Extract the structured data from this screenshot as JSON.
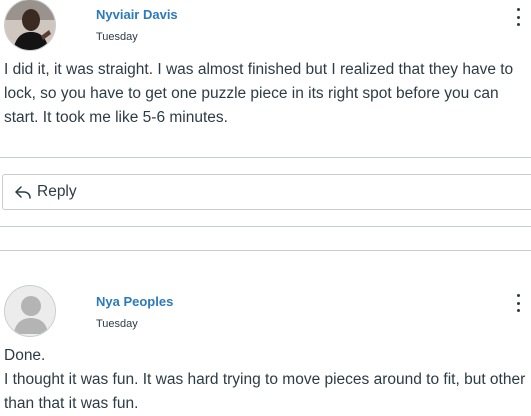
{
  "posts": [
    {
      "author": "Nyviair Davis",
      "date": "Tuesday",
      "avatar": "user-photo-avatar",
      "body": [
        "I did it, it was straight. I was almost finished but I realized that they have to lock, so you have to get one puzzle piece in its right spot before you can start. It took me like 5-6 minutes."
      ]
    },
    {
      "author": "Nya Peoples",
      "date": "Tuesday",
      "avatar": "default-user-avatar",
      "body": [
        "Done.",
        "I thought it was fun. It was hard trying to move pieces around to fit, but other than that it was fun."
      ]
    }
  ],
  "reply": {
    "label": "Reply",
    "icon": "reply-arrow-icon"
  },
  "menu_icon": "kebab-menu-icon",
  "colors": {
    "link": "#2b7abc",
    "text": "#2d3b45",
    "border": "#c7cdd1"
  }
}
